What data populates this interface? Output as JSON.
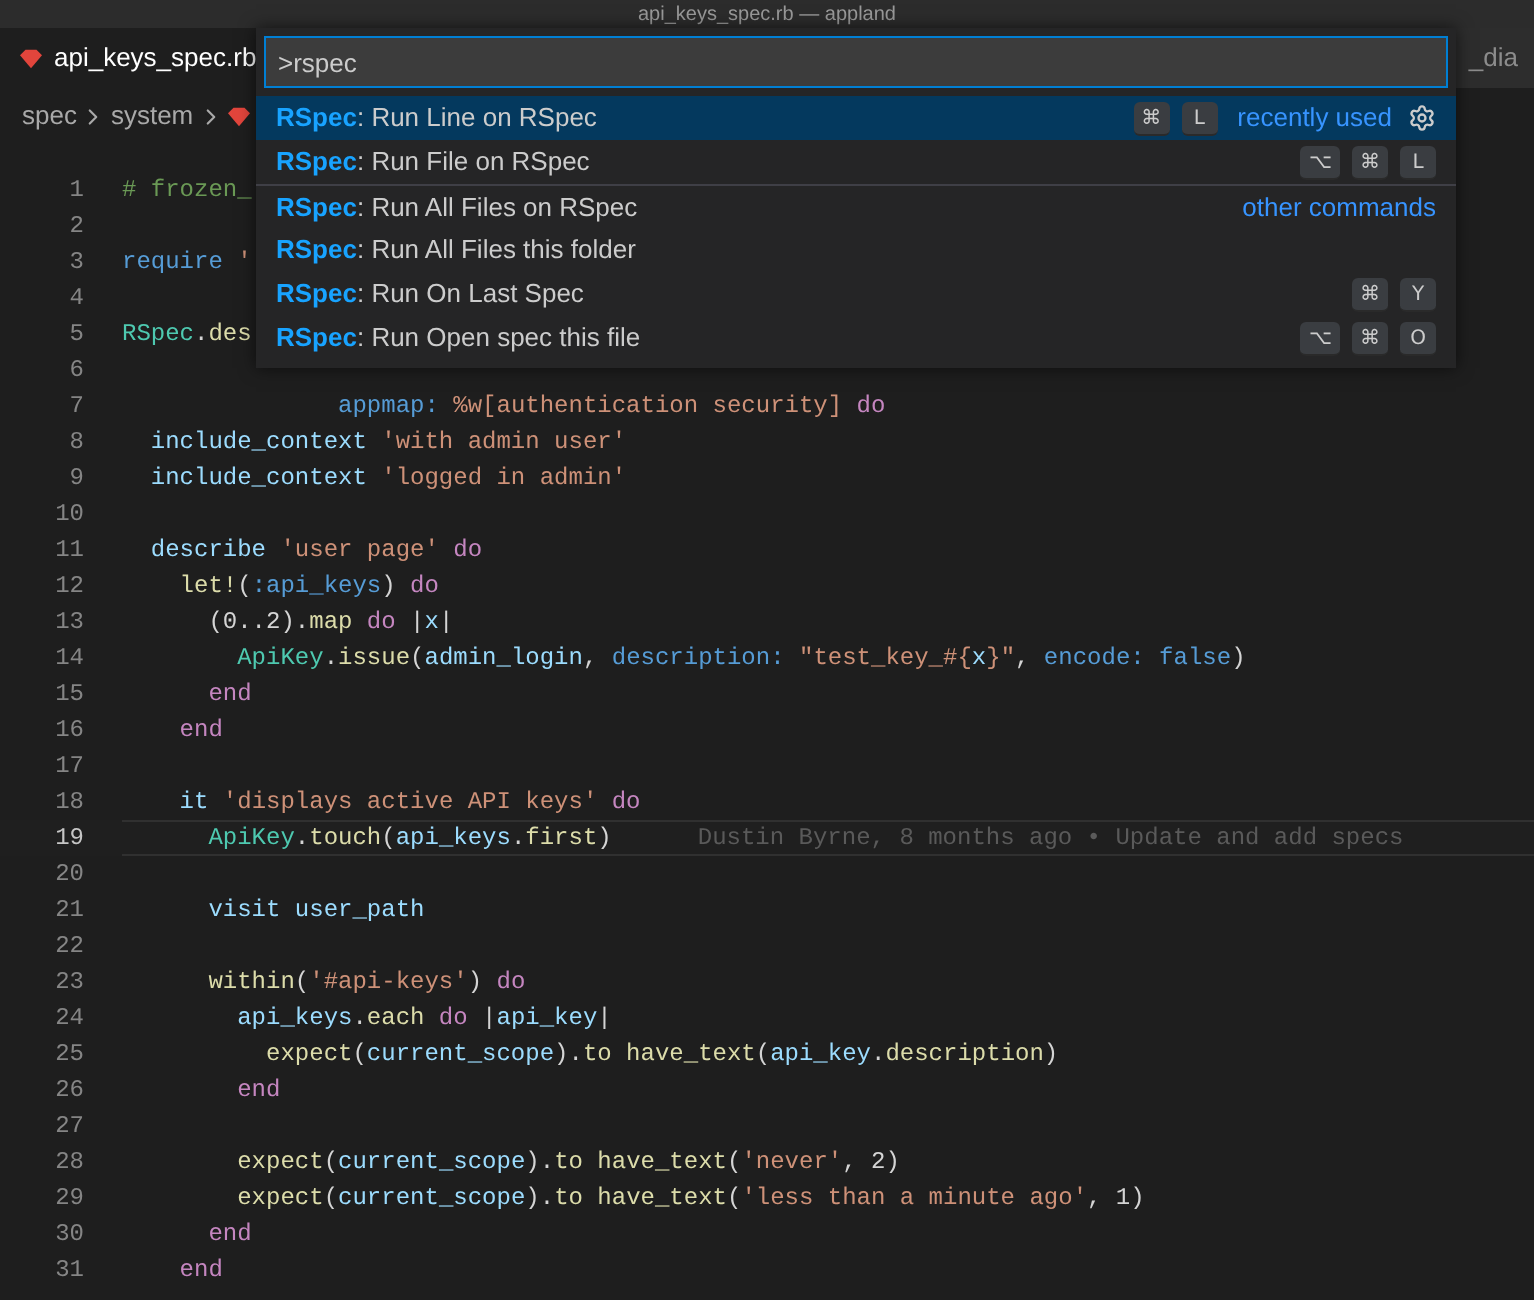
{
  "window": {
    "title": "api_keys_spec.rb — appland"
  },
  "tabs": [
    {
      "label": "api_keys_spec.rb",
      "selected": true,
      "kind": "ruby"
    },
    {
      "label": "_dia",
      "selected": false,
      "kind": "diagram"
    }
  ],
  "breadcrumb": [
    "spec",
    "system"
  ],
  "command_palette": {
    "value": ">rspec",
    "items": [
      {
        "match": "RSpec",
        "label": ": Run Line on RSpec",
        "keys": [
          "⌘",
          "L"
        ],
        "note": "recently used",
        "selected": true,
        "separator": false
      },
      {
        "match": "RSpec",
        "label": ": Run File on RSpec",
        "keys": [
          "⌥",
          "⌘",
          "L"
        ],
        "selected": false,
        "separator": false
      },
      {
        "match": "RSpec",
        "label": ": Run All Files on RSpec",
        "note": "other commands",
        "selected": false,
        "separator": true
      },
      {
        "match": "RSpec",
        "label": ": Run All Files this folder",
        "selected": false,
        "separator": false
      },
      {
        "match": "RSpec",
        "label": ": Run On Last Spec",
        "keys": [
          "⌘",
          "Y"
        ],
        "selected": false,
        "separator": false
      },
      {
        "match": "RSpec",
        "label": ": Run Open spec this file",
        "keys": [
          "⌥",
          "⌘",
          "O"
        ],
        "selected": false,
        "separator": false
      }
    ]
  },
  "editor": {
    "lines": [
      {
        "number": "1",
        "active": false,
        "tokens": [
          {
            "kind": "comment",
            "text": "# frozen_"
          }
        ]
      },
      {
        "number": "2",
        "active": false
      },
      {
        "number": "3",
        "active": false,
        "tokens": [
          {
            "kind": "builtin",
            "text": "require"
          },
          {
            "kind": "string",
            "text": " '"
          }
        ]
      },
      {
        "number": "4",
        "active": false
      },
      {
        "number": "5",
        "active": false,
        "tokens": [
          {
            "kind": "constant",
            "text": "RSpec"
          },
          {
            "kind": "plain",
            "text": "."
          },
          {
            "kind": "method",
            "text": "des"
          }
        ]
      },
      {
        "number": "6",
        "active": false
      },
      {
        "number": "7",
        "active": false,
        "tokens": [
          {
            "kind": "label",
            "text": "               appmap:"
          },
          {
            "kind": "string",
            "text": " %w[authentication security]"
          },
          {
            "kind": "keyword",
            "text": " do"
          }
        ]
      },
      {
        "number": "8",
        "active": false,
        "tokens": [
          {
            "kind": "variable",
            "text": "  include_context"
          },
          {
            "kind": "string",
            "text": " 'with admin user'"
          }
        ]
      },
      {
        "number": "9",
        "active": false,
        "tokens": [
          {
            "kind": "variable",
            "text": "  include_context"
          },
          {
            "kind": "string",
            "text": " 'logged in admin'"
          }
        ]
      },
      {
        "number": "10",
        "active": false
      },
      {
        "number": "11",
        "active": false,
        "tokens": [
          {
            "kind": "variable",
            "text": "  describe"
          },
          {
            "kind": "string",
            "text": " 'user page'"
          },
          {
            "kind": "keyword",
            "text": " do"
          }
        ]
      },
      {
        "number": "12",
        "active": false,
        "tokens": [
          {
            "kind": "method",
            "text": "    let!"
          },
          {
            "kind": "plain",
            "text": "("
          },
          {
            "kind": "label",
            "text": ":api_keys"
          },
          {
            "kind": "plain",
            "text": ")"
          },
          {
            "kind": "keyword",
            "text": " do"
          }
        ]
      },
      {
        "number": "13",
        "active": false,
        "tokens": [
          {
            "kind": "plain",
            "text": "      (0..2)."
          },
          {
            "kind": "method",
            "text": "map"
          },
          {
            "kind": "keyword",
            "text": " do"
          },
          {
            "kind": "plain",
            "text": " |"
          },
          {
            "kind": "variable",
            "text": "x"
          },
          {
            "kind": "plain",
            "text": "|"
          }
        ]
      },
      {
        "number": "14",
        "active": false,
        "tokens": [
          {
            "kind": "constant",
            "text": "        ApiKey"
          },
          {
            "kind": "plain",
            "text": "."
          },
          {
            "kind": "method",
            "text": "issue"
          },
          {
            "kind": "plain",
            "text": "("
          },
          {
            "kind": "variable",
            "text": "admin_login"
          },
          {
            "kind": "plain",
            "text": ","
          },
          {
            "kind": "label",
            "text": " description:"
          },
          {
            "kind": "string",
            "text": " \"test_key_#{"
          },
          {
            "kind": "variable",
            "text": "x"
          },
          {
            "kind": "string",
            "text": "}\""
          },
          {
            "kind": "plain",
            "text": ","
          },
          {
            "kind": "label",
            "text": " encode:"
          },
          {
            "kind": "builtin",
            "text": " false"
          },
          {
            "kind": "plain",
            "text": ")"
          }
        ]
      },
      {
        "number": "15",
        "active": false,
        "tokens": [
          {
            "kind": "keyword",
            "text": "      end"
          }
        ]
      },
      {
        "number": "16",
        "active": false,
        "tokens": [
          {
            "kind": "keyword",
            "text": "    end"
          }
        ]
      },
      {
        "number": "17",
        "active": false
      },
      {
        "number": "18",
        "active": false,
        "tokens": [
          {
            "kind": "variable",
            "text": "    it"
          },
          {
            "kind": "string",
            "text": " 'displays active API keys'"
          },
          {
            "kind": "keyword",
            "text": " do"
          }
        ]
      },
      {
        "number": "19",
        "active": true,
        "blame": "Dustin Byrne, 8 months ago • Update and add specs",
        "tokens": [
          {
            "kind": "constant",
            "text": "      ApiKey"
          },
          {
            "kind": "plain",
            "text": "."
          },
          {
            "kind": "method",
            "text": "touch"
          },
          {
            "kind": "plain",
            "text": "("
          },
          {
            "kind": "variable",
            "text": "api_keys"
          },
          {
            "kind": "plain",
            "text": "."
          },
          {
            "kind": "method",
            "text": "first"
          },
          {
            "kind": "plain",
            "text": ")"
          }
        ]
      },
      {
        "number": "20",
        "active": false
      },
      {
        "number": "21",
        "active": false,
        "tokens": [
          {
            "kind": "variable",
            "text": "      visit user_path"
          }
        ]
      },
      {
        "number": "22",
        "active": false
      },
      {
        "number": "23",
        "active": false,
        "tokens": [
          {
            "kind": "method",
            "text": "      within"
          },
          {
            "kind": "plain",
            "text": "("
          },
          {
            "kind": "string",
            "text": "'#api-keys'"
          },
          {
            "kind": "plain",
            "text": ")"
          },
          {
            "kind": "keyword",
            "text": " do"
          }
        ]
      },
      {
        "number": "24",
        "active": false,
        "tokens": [
          {
            "kind": "variable",
            "text": "        api_keys"
          },
          {
            "kind": "plain",
            "text": "."
          },
          {
            "kind": "method",
            "text": "each"
          },
          {
            "kind": "keyword",
            "text": " do"
          },
          {
            "kind": "plain",
            "text": " |"
          },
          {
            "kind": "variable",
            "text": "api_key"
          },
          {
            "kind": "plain",
            "text": "|"
          }
        ]
      },
      {
        "number": "25",
        "active": false,
        "tokens": [
          {
            "kind": "method",
            "text": "          expect"
          },
          {
            "kind": "plain",
            "text": "("
          },
          {
            "kind": "variable",
            "text": "current_scope"
          },
          {
            "kind": "plain",
            "text": ")."
          },
          {
            "kind": "method",
            "text": "to have_text"
          },
          {
            "kind": "plain",
            "text": "("
          },
          {
            "kind": "variable",
            "text": "api_key"
          },
          {
            "kind": "plain",
            "text": "."
          },
          {
            "kind": "method",
            "text": "description"
          },
          {
            "kind": "plain",
            "text": ")"
          }
        ]
      },
      {
        "number": "26",
        "active": false,
        "tokens": [
          {
            "kind": "keyword",
            "text": "        end"
          }
        ]
      },
      {
        "number": "27",
        "active": false
      },
      {
        "number": "28",
        "active": false,
        "tokens": [
          {
            "kind": "method",
            "text": "        expect"
          },
          {
            "kind": "plain",
            "text": "("
          },
          {
            "kind": "variable",
            "text": "current_scope"
          },
          {
            "kind": "plain",
            "text": ")."
          },
          {
            "kind": "method",
            "text": "to have_text"
          },
          {
            "kind": "plain",
            "text": "("
          },
          {
            "kind": "string",
            "text": "'never'"
          },
          {
            "kind": "plain",
            "text": ", 2)"
          }
        ]
      },
      {
        "number": "29",
        "active": false,
        "tokens": [
          {
            "kind": "method",
            "text": "        expect"
          },
          {
            "kind": "plain",
            "text": "("
          },
          {
            "kind": "variable",
            "text": "current_scope"
          },
          {
            "kind": "plain",
            "text": ")."
          },
          {
            "kind": "method",
            "text": "to have_text"
          },
          {
            "kind": "plain",
            "text": "("
          },
          {
            "kind": "string",
            "text": "'less than a minute ago'"
          },
          {
            "kind": "plain",
            "text": ", 1)"
          }
        ]
      },
      {
        "number": "30",
        "active": false,
        "tokens": [
          {
            "kind": "keyword",
            "text": "      end"
          }
        ]
      },
      {
        "number": "31",
        "active": false,
        "tokens": [
          {
            "kind": "keyword",
            "text": "    end"
          }
        ]
      }
    ]
  }
}
